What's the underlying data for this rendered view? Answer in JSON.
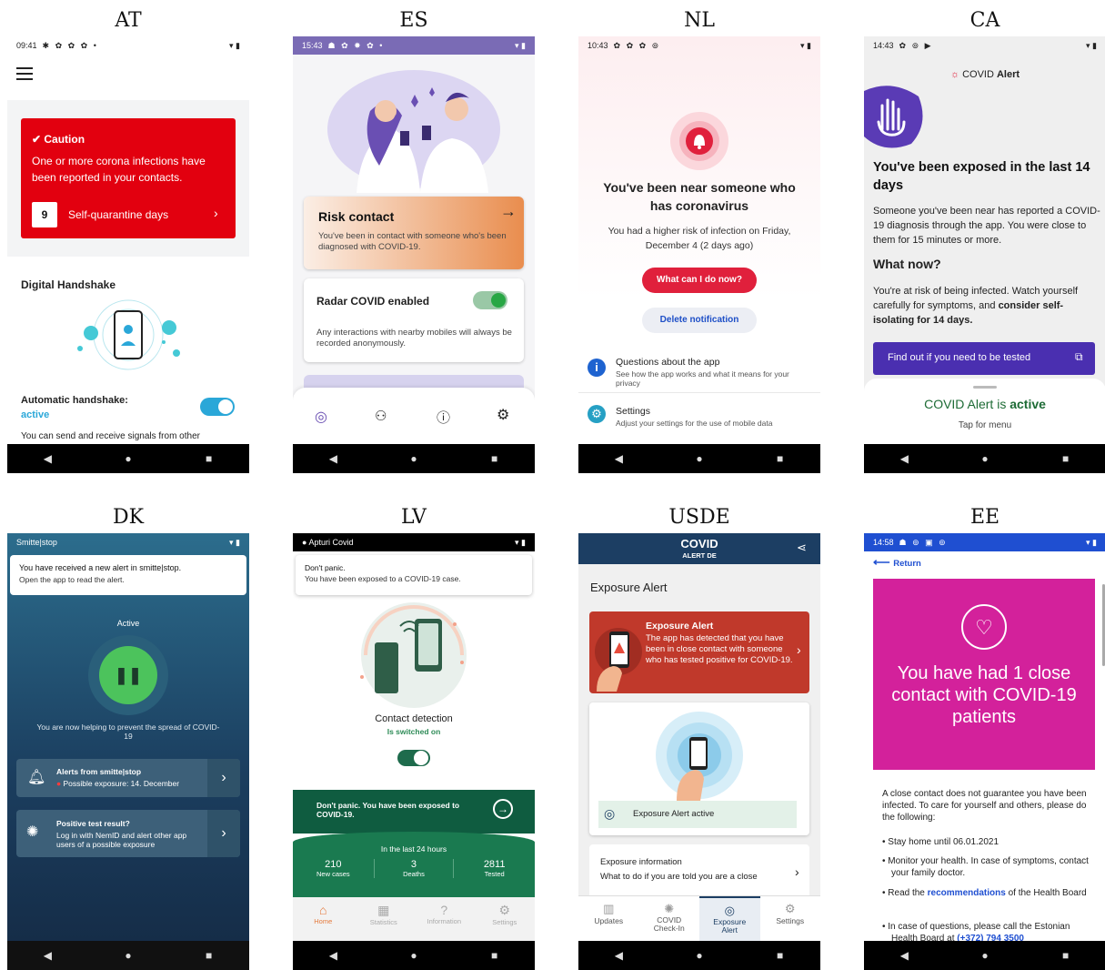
{
  "nav": {
    "back": "◀",
    "home": "●",
    "recent": "■"
  },
  "at": {
    "label": "AT",
    "time": "09:41",
    "status_icons": "✱ ✿ ✿ ✿ •",
    "right_icons": "▾ ▮",
    "caution": "Caution",
    "caution_text": "One or more corona infections have been reported in your contacts.",
    "days": "9",
    "days_label": "Self-quarantine days",
    "handshake_title": "Digital Handshake",
    "auto_label": "Automatic handshake:",
    "auto_value": "active",
    "auto_desc": "You can send and receive signals from other"
  },
  "es": {
    "label": "ES",
    "time": "15:43",
    "status_icons": "☗ ✿ ✸ ✿ •",
    "right_icons": "▾ ▮",
    "risk_title": "Risk contact",
    "risk_text": "You've been in contact with someone who's been diagnosed with COVID-19.",
    "radar_title": "Radar COVID enabled",
    "radar_text": "Any interactions with nearby mobiles will always be recorded anonymously."
  },
  "nl": {
    "label": "NL",
    "time": "10:43",
    "status_icons": "✿ ✿ ✿ ⊚",
    "right_icons": "▾ ▮",
    "heading": "You've been near someone who has coronavirus",
    "body": "You had a higher risk of infection on Friday, December 4 (2 days ago)",
    "btn_primary": "What can I do now?",
    "btn_secondary": "Delete notification",
    "q_title": "Questions about the app",
    "q_sub": "See how the app works and what it means for your privacy",
    "s_title": "Settings",
    "s_sub": "Adjust your settings for the use of mobile data"
  },
  "ca": {
    "label": "CA",
    "time": "14:43",
    "status_icons": "✿ ⊚ ▶",
    "right_icons": "▾ ▮",
    "app_name_prefix": "COVID",
    "app_name_suffix": "Alert",
    "heading": "You've been exposed in the last 14 days",
    "body": "Someone you've been near has reported a COVID-19 diagnosis through the app. You were close to them for 15 minutes or more.",
    "what_now": "What now?",
    "risk_text": "You're at risk of being infected. Watch yourself carefully for symptoms, and",
    "risk_bold": "consider self-isolating for 14 days.",
    "btn": "Find out if you need to be tested",
    "status_prefix": "COVID Alert is",
    "status_value": "active",
    "tap": "Tap for menu"
  },
  "dk": {
    "label": "DK",
    "app": "Smitte|stop",
    "right_icons": "▾ ▮",
    "notif_title": "You have received a new alert in smitte|stop.",
    "notif_sub": "Open the app to read the alert.",
    "active": "Active",
    "helping": "You are now helping to prevent the spread of COVID-19",
    "alerts_title": "Alerts from smitte|stop",
    "alerts_sub": "Possible exposure: 14. December",
    "test_title": "Positive test result?",
    "test_sub": "Log in with NemID and alert other app users of a possible exposure"
  },
  "lv": {
    "label": "LV",
    "app": "Apturi Covid",
    "right_icons": "▾ ▮",
    "notif_title": "Don't panic.",
    "notif_sub": "You have been exposed to a COVID-19 case.",
    "detect": "Contact detection",
    "detect_status": "Is switched on",
    "banner": "Don't panic. You have been exposed to COVID-19.",
    "last24": "In the last 24 hours",
    "stats": [
      {
        "value": "210",
        "label": "New cases"
      },
      {
        "value": "3",
        "label": "Deaths"
      },
      {
        "value": "2811",
        "label": "Tested"
      }
    ],
    "tabs": [
      "Home",
      "Statistics",
      "Information",
      "Settings"
    ]
  },
  "usde": {
    "label": "USDE",
    "logo_top": "COVID",
    "logo_bottom": "ALERT DE",
    "section": "Exposure Alert",
    "card_title": "Exposure Alert",
    "card_text": "The app has detected that you have been in close contact with someone who has tested positive for COVID-19.",
    "active": "Exposure Alert active",
    "info_title": "Exposure information",
    "info_text": "What to do if you are told you are a close",
    "tabs": [
      "Updates",
      "COVID Check-In",
      "Exposure Alert",
      "Settings"
    ]
  },
  "ee": {
    "label": "EE",
    "time": "14:58",
    "status_icons": "☗ ⊚ ▣ ⊚",
    "right_icons": "▾ ▮",
    "back": "Return",
    "hero": "You have had 1 close contact with COVID-19 patients",
    "intro": "A close contact does not guarantee you have been infected. To care for yourself and others, please do the following:",
    "b1": "Stay home until 06.01.2021",
    "b2": "Monitor your health. In case of symptoms, contact your family doctor.",
    "b3_pre": "Read the",
    "b3_link": "recommendations",
    "b3_post": "of the Health Board",
    "b4": "In case of questions, please call the Estonian Health Board at",
    "b4_link": "(+372) 794 3500"
  }
}
